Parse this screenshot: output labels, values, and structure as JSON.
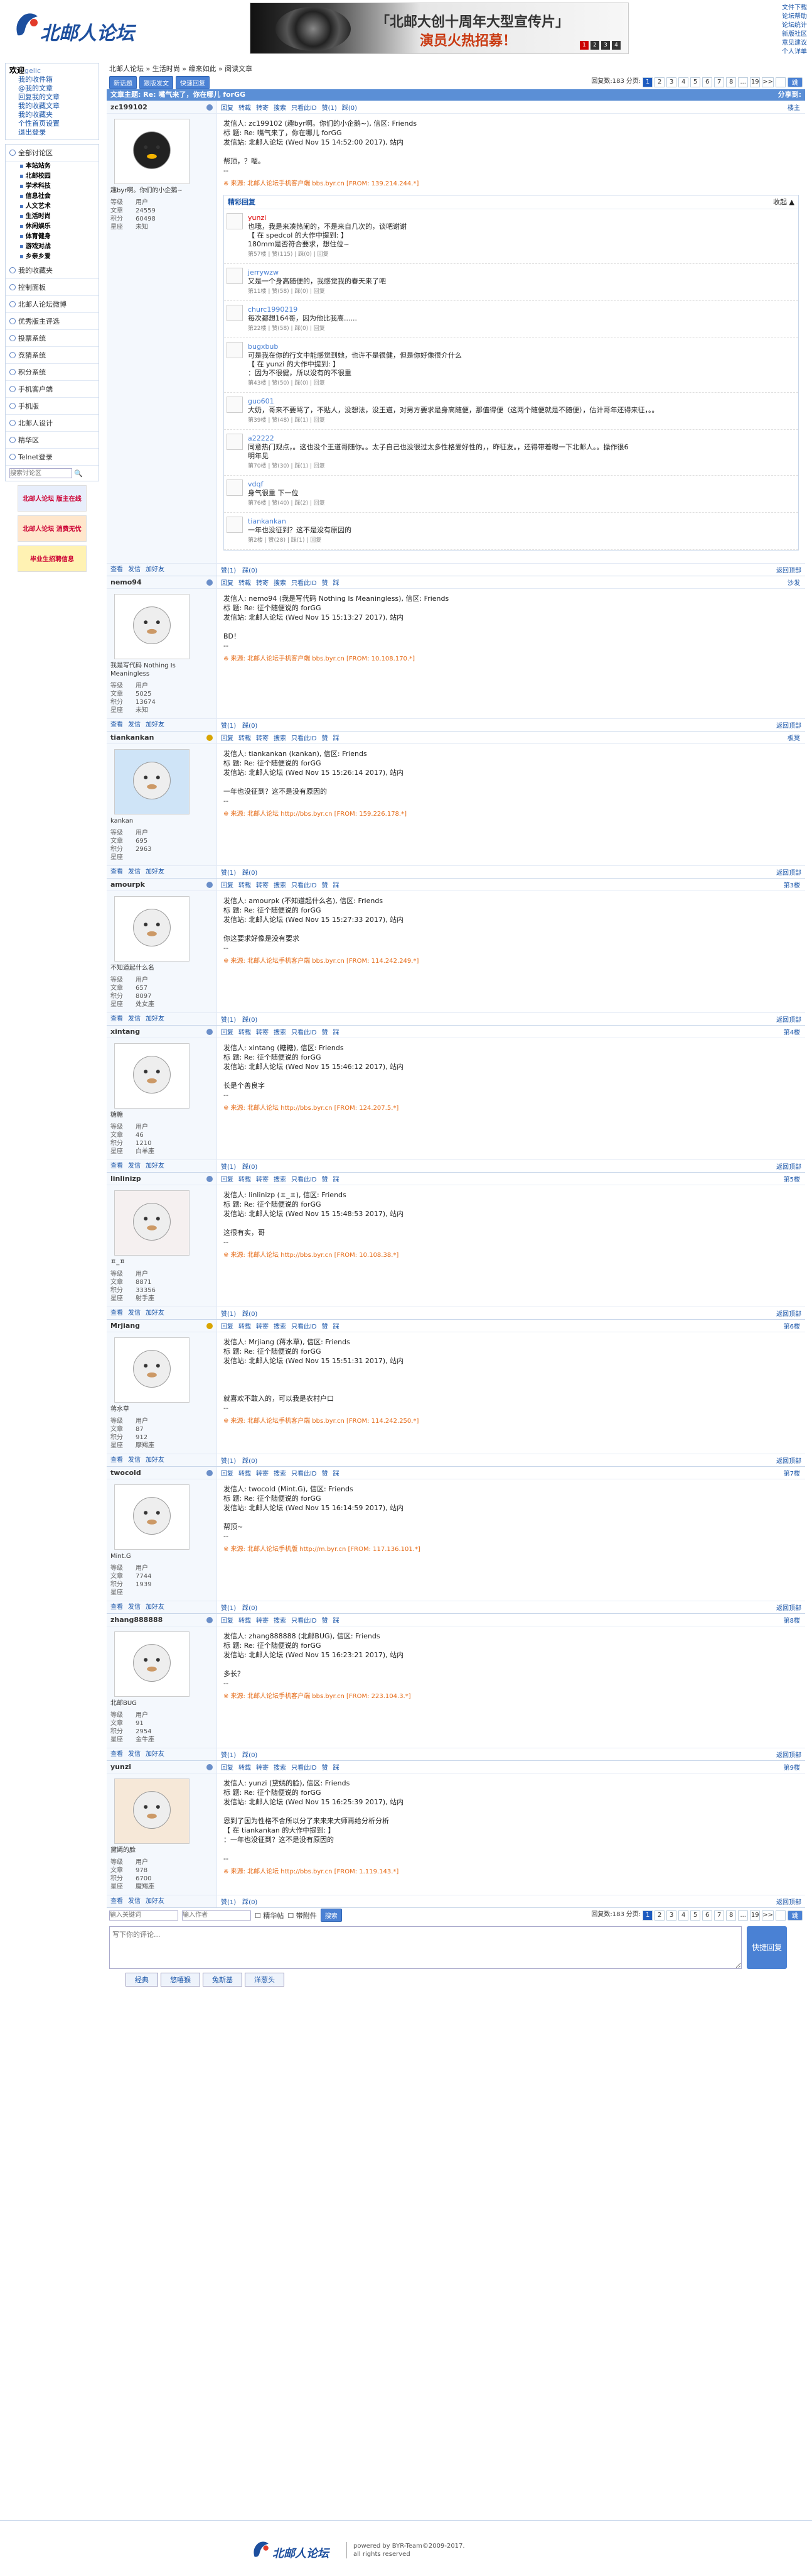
{
  "site": {
    "logo_text": "北邮人论坛",
    "toplinks": [
      "文件下载",
      "论坛帮助",
      "论坛统计",
      "新版社区",
      "意见建议",
      "个人详单"
    ]
  },
  "banner": {
    "line1": "「北邮大创十周年大型宣传片」",
    "line2": "演员火热招募！",
    "dots": [
      "1",
      "2",
      "3",
      "4"
    ]
  },
  "sidebar": {
    "welcome": "欢迎",
    "user": "gelic",
    "user_links": [
      "我的收件箱",
      "@我的文章",
      "回复我的文章",
      "我的收藏文章",
      "我的收藏夹",
      "个性首页设置",
      "退出登录"
    ],
    "sections": [
      {
        "label": "全部讨论区",
        "subs": [
          "本站站务",
          "北邮校园",
          "学术科技",
          "信息社会",
          "人文艺术",
          "生活时尚",
          "休闲娱乐",
          "体育健身",
          "游戏对战",
          "乡亲乡爱"
        ]
      },
      {
        "label": "我的收藏夹",
        "subs": []
      },
      {
        "label": "控制面板",
        "subs": []
      },
      {
        "label": "北邮人论坛微博",
        "subs": []
      },
      {
        "label": "优秀版主评选",
        "subs": []
      },
      {
        "label": "投票系统",
        "subs": []
      },
      {
        "label": "竞猜系统",
        "subs": []
      },
      {
        "label": "积分系统",
        "subs": []
      },
      {
        "label": "手机客户端",
        "subs": []
      },
      {
        "label": "手机版",
        "subs": []
      },
      {
        "label": "北邮人设计",
        "subs": []
      },
      {
        "label": "精华区",
        "subs": []
      },
      {
        "label": "Telnet登录",
        "subs": []
      }
    ],
    "search_placeholder": "搜索讨论区",
    "ads": [
      "北邮人论坛 版主在线",
      "北邮人论坛 消费无忧",
      "毕业生招聘信息"
    ]
  },
  "breadcrumb": "北邮人论坛 » 生活时尚 » 缘来如此 » 阅读文章",
  "toolbar": {
    "buttons": [
      "新话题",
      "跟版发文",
      "快速回复"
    ],
    "count_label": "回复数:183",
    "page_label": "分页:",
    "pages": [
      "1",
      "2",
      "3",
      "4",
      "5",
      "6",
      "7",
      "8",
      "...",
      "19",
      ">>"
    ],
    "go": "跳"
  },
  "thread": {
    "title": "文章主题: Re: 嘴气来了，你在哪儿 forGG",
    "share": "分享到:"
  },
  "post_actions": [
    "回复",
    "转载",
    "转寄",
    "搜索",
    "只看此ID",
    "赞(1)",
    "踩(0)"
  ],
  "post_actions_plain": [
    "回复",
    "转载",
    "转寄",
    "搜索",
    "只看此ID",
    "赞",
    "踩"
  ],
  "foot_links": [
    "查看",
    "发信",
    "加好友"
  ],
  "back_top": "返回顶部",
  "labels": {
    "level": "等级",
    "articles": "文章",
    "points": "积分",
    "life": "星座"
  },
  "posts": [
    {
      "user": "zc199102",
      "floor": "楼主",
      "sig": "趣byr啊。你们的小企鹅~",
      "kv": [
        "用户",
        "24559",
        "60498",
        "未知"
      ],
      "body": [
        "发信人: zc199102 (趣byr啊。你们的小企鹅~), 信区: Friends",
        "标  题: Re: 嘴气来了，你在哪儿 forGG",
        "发信站: 北邮人论坛 (Wed Nov 15 14:52:00 2017), 站内",
        "",
        "帮顶，？嗯。",
        "--"
      ],
      "src": "※ 来源: 北邮人论坛手机客户端 bbs.byr.cn [FROM: 139.214.244.*]"
    },
    {
      "user": "nemo94",
      "floor": "沙发",
      "sig": "我是写代码 Nothing Is Meaningless",
      "kv": [
        "用户",
        "5025",
        "13674",
        "未知"
      ],
      "body": [
        "发信人: nemo94 (我是写代码 Nothing Is Meaningless), 信区: Friends",
        "标  题: Re: 征个随便说的 forGG",
        "发信站: 北邮人论坛 (Wed Nov 15 15:13:27 2017), 站内",
        "",
        "BD！",
        "--"
      ],
      "src": "※ 来源: 北邮人论坛手机客户端 bbs.byr.cn [FROM: 10.108.170.*]"
    },
    {
      "user": "tiankankan",
      "floor": "板凳",
      "sig": "kankan",
      "kv": [
        "用户",
        "695",
        "2963",
        ""
      ],
      "body": [
        "发信人: tiankankan (kankan), 信区: Friends",
        "标  题: Re: 征个随便说的 forGG",
        "发信站: 北邮人论坛 (Wed Nov 15 15:26:14 2017), 站内",
        "",
        "一年也没征到？这不是没有原因的",
        "--"
      ],
      "src": "※ 来源: 北邮人论坛 http://bbs.byr.cn [FROM: 159.226.178.*]"
    },
    {
      "user": "amourpk",
      "floor": "第3楼",
      "sig": "不知道起什么名",
      "kv": [
        "用户",
        "657",
        "8097",
        "处女座"
      ],
      "body": [
        "发信人: amourpk (不知道起什么名), 信区: Friends",
        "标  题: Re: 征个随便说的 forGG",
        "发信站: 北邮人论坛 (Wed Nov 15 15:27:33 2017), 站内",
        "",
        "你这要求好像是没有要求",
        "--"
      ],
      "src": "※ 来源: 北邮人论坛手机客户端 bbs.byr.cn [FROM: 114.242.249.*]"
    },
    {
      "user": "xintang",
      "floor": "第4楼",
      "sig": "糖糖",
      "kv": [
        "用户",
        "46",
        "1210",
        "白羊座"
      ],
      "body": [
        "发信人: xintang (糖糖), 信区: Friends",
        "标  题: Re: 征个随便说的 forGG",
        "发信站: 北邮人论坛 (Wed Nov 15 15:46:12 2017), 站内",
        "",
        "长是个善良字",
        "--"
      ],
      "src": "※ 来源: 北邮人论坛 http://bbs.byr.cn [FROM: 124.207.5.*]"
    },
    {
      "user": "linlinizp",
      "floor": "第5楼",
      "sig": "ㅍ_ㅍ",
      "kv": [
        "用户",
        "8871",
        "33356",
        "射手座"
      ],
      "body": [
        "发信人: linlinizp (ㅍ_ㅍ), 信区: Friends",
        "标  题: Re: 征个随便说的 forGG",
        "发信站: 北邮人论坛 (Wed Nov 15 15:48:53 2017), 站内",
        "",
        "这很有实，哥",
        "--"
      ],
      "src": "※ 来源: 北邮人论坛 http://bbs.byr.cn [FROM: 10.108.38.*]"
    },
    {
      "user": "Mrjiang",
      "floor": "第6楼",
      "sig": "蒋水草",
      "kv": [
        "用户",
        "87",
        "912",
        "摩羯座"
      ],
      "body": [
        "发信人: Mrjiang (蒋水草), 信区: Friends",
        "标  题: Re: 征个随便说的 forGG",
        "发信站: 北邮人论坛 (Wed Nov 15 15:51:31 2017), 站内",
        "",
        "",
        "",
        "就喜欢不敢入的，可以我是农村户口",
        "--"
      ],
      "src": "※ 来源: 北邮人论坛手机客户端 bbs.byr.cn [FROM: 114.242.250.*]"
    },
    {
      "user": "twocold",
      "floor": "第7楼",
      "sig": "Mint.G",
      "kv": [
        "用户",
        "7744",
        "1939",
        ""
      ],
      "body": [
        "发信人: twocold (Mint.G), 信区: Friends",
        "标  题: Re: 征个随便说的 forGG",
        "发信站: 北邮人论坛 (Wed Nov 15 16:14:59 2017), 站内",
        "",
        "帮顶~",
        "--"
      ],
      "src": "※ 来源: 北邮人论坛手机版 http://m.byr.cn [FROM: 117.136.101.*]"
    },
    {
      "user": "zhang888888",
      "floor": "第8楼",
      "sig": "北邮BUG",
      "kv": [
        "用户",
        "91",
        "2954",
        "金牛座"
      ],
      "body": [
        "发信人: zhang888888 (北邮BUG), 信区: Friends",
        "标  题: Re: 征个随便说的 forGG",
        "发信站: 北邮人论坛 (Wed Nov 15 16:23:21 2017), 站内",
        "",
        "多长？",
        "--"
      ],
      "src": "※ 来源: 北邮人论坛手机客户端 bbs.byr.cn [FROM: 223.104.3.*]"
    },
    {
      "user": "yunzi",
      "floor": "第9楼",
      "sig": "黛嫣的脸",
      "kv": [
        "用户",
        "978",
        "6700",
        "魔羯座"
      ],
      "body": [
        "发信人: yunzi (黛嫣的脸), 信区: Friends",
        "标  题: Re: 征个随便说的 forGG",
        "发信站: 北邮人论坛 (Wed Nov 15 16:25:39 2017), 站内",
        "",
        "恩到了国为性格不合所以分了来来来大师再给分析分析",
        "【 在 tiankankan 的大作中提到: 】",
        "：一年也没征到？这不是没有原因的",
        "",
        "--"
      ],
      "src": "※ 来源: 北邮人论坛 http://bbs.byr.cn [FROM: 1.119.143.*]"
    }
  ],
  "hot": {
    "title": "精彩回复",
    "fold": "收起 ▲",
    "items": [
      {
        "name": "yunzi",
        "red": true,
        "lines": [
          "也哦，我是来凑热闹的，不是来自几次的，谈吧谢谢",
          "【 在 spedcol 的大作中提到: 】",
          "180mm是否符合要求，想住位~"
        ],
        "stat": "第57楼  |  赞(115)  |  踩(0)  |  回复"
      },
      {
        "name": "jerrywzw",
        "red": false,
        "lines": [
          "又是一个身高随便的，我感觉我的春天来了吧"
        ],
        "stat": "第11楼  |  赞(58)  |  踩(0)  |  回复"
      },
      {
        "name": "churc1990219",
        "red": false,
        "lines": [
          "每次都想164哥，因为他比我高......"
        ],
        "stat": "第22楼  |  赞(58)  |  踩(0)  |  回复"
      },
      {
        "name": "bugxbub",
        "red": false,
        "lines": [
          "可是我在你的行文中能感觉到她，也许不是很健，但是你好像很介什么",
          "【 在 yunzi 的大作中提到: 】",
          "：因为不很健，所以没有的不很重"
        ],
        "stat": "第43楼  |  赞(50)  |  踩(0)  |  回复"
      },
      {
        "name": "guo601",
        "red": false,
        "lines": [
          "大奶，哥来不要骂了，不贴人，没想法，没王道，对男方要求是身高随便，那值得便（这两个随便就是不随便），估计哥年还得来征，。。"
        ],
        "stat": "第39楼  |  赞(48)  |  踩(1)  |  回复"
      },
      {
        "name": "a22222",
        "red": false,
        "lines": [
          "同意热门观点，。这也没个王道哥随你。。太子自己也没很过太多性格爱好性的，，昨征友。，还得带着嗯一下北邮人。。操作很6",
          "明年见"
        ],
        "stat": "第70楼  |  赞(30)  |  踩(1)  |  回复"
      },
      {
        "name": "vdqf",
        "red": false,
        "lines": [
          "身气很重 下一位"
        ],
        "stat": "第76楼  |  赞(40)  |  踩(2)  |  回复"
      },
      {
        "name": "tiankankan",
        "red": false,
        "lines": [
          "一年也没征到？这不是没有原因的"
        ],
        "stat": "第2楼  |  赞(28)  |  踩(1)  |  回复"
      }
    ]
  },
  "bottom": {
    "search_placeholder": "输入关键词",
    "author_placeholder": "输入作者",
    "checks": [
      "精华帖",
      "带附件"
    ],
    "go": "搜索",
    "count": "回复数:183",
    "reply_placeholder": "写下你的评论...",
    "send": "快捷回复",
    "emotions": [
      "经典",
      "悠嘻猴",
      "兔斯基",
      "洋葱头"
    ]
  },
  "footer": {
    "logo": "北邮人论坛",
    "line1": "powered by BYR-Team©2009-2017.",
    "line2": "all rights reserved"
  }
}
